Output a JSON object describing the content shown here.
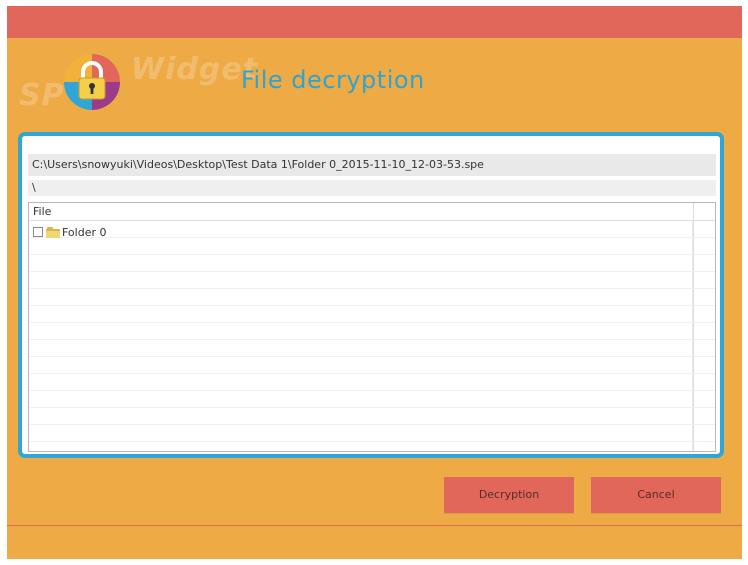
{
  "header": {
    "brand_left": "SP",
    "brand_right": "Widget",
    "title": "File decryption"
  },
  "panel": {
    "path": "C:\\Users\\snowyuki\\Videos\\Desktop\\Test Data 1\\Folder 0_2015-11-10_12-03-53.spe",
    "subpath": "\\",
    "column_header": "File",
    "items": [
      {
        "name": "Folder 0",
        "checked": false,
        "icon": "folder-icon"
      }
    ]
  },
  "buttons": {
    "decrypt_label": "Decryption",
    "cancel_label": "Cancel"
  },
  "colors": {
    "background": "#eeaa45",
    "topbar": "#e2675b",
    "accent": "#2fa6d6",
    "button": "#e2675b",
    "title": "#31a3cf"
  }
}
